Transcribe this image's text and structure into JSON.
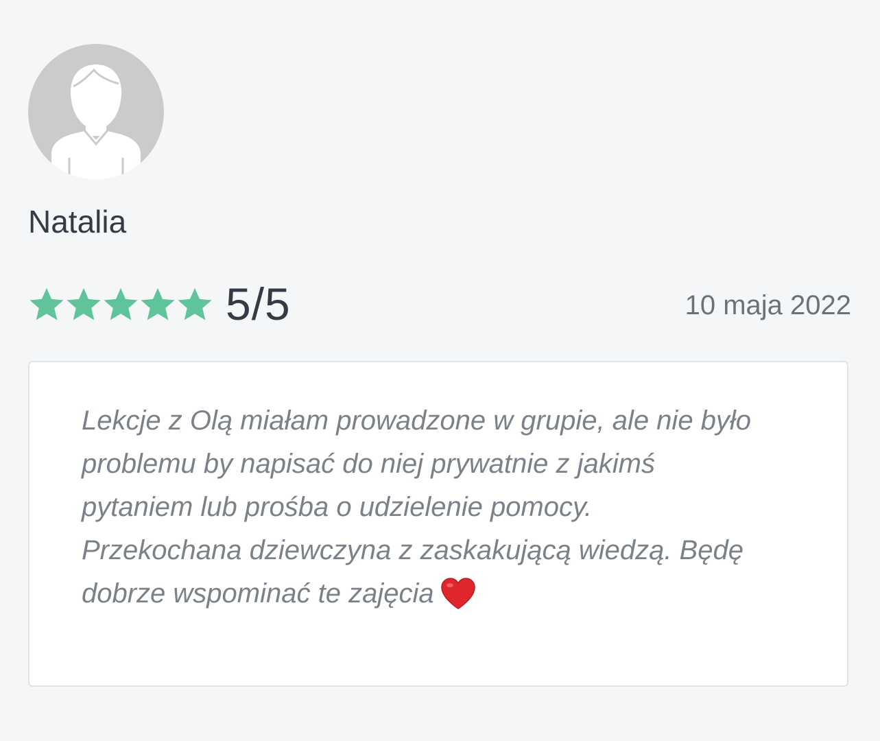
{
  "review": {
    "author": "Natalia",
    "avatar_icon": "user-silhouette-icon",
    "rating": {
      "value": 5,
      "max": 5,
      "label": "5/5",
      "star_color": "#5fc49a"
    },
    "date": "10 maja 2022",
    "comment": "Lekcje z Olą miałam prowadzone w grupie, ale nie było\nproblemu by napisać do niej prywatnie z jakimś\npytaniem lub prośba o udzielenie pomocy.\nPrzekochana dziewczyna z zaskakującą wiedzą. Będę\ndobrze wspominać te zajęcia",
    "comment_emoji": "heart-icon"
  }
}
